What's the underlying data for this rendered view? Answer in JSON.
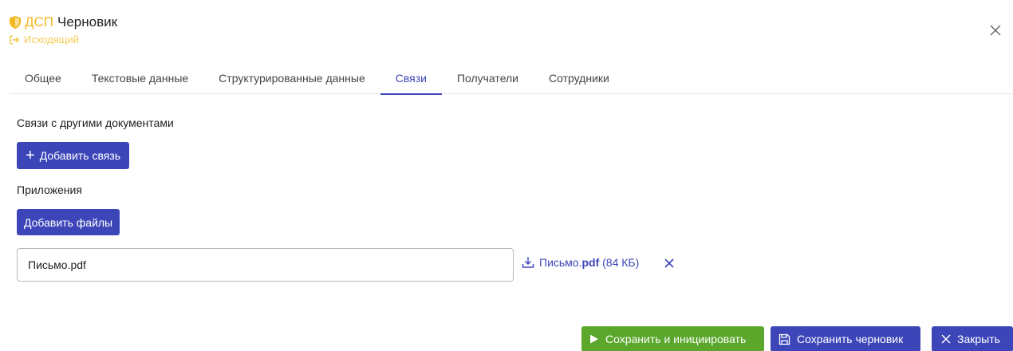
{
  "header": {
    "classification": "ДСП",
    "title": "Черновик",
    "subtitle": "Исходящий"
  },
  "tabs": [
    {
      "label": "Общее",
      "active": false
    },
    {
      "label": "Текстовые данные",
      "active": false
    },
    {
      "label": "Структурированные данные",
      "active": false
    },
    {
      "label": "Связи",
      "active": true
    },
    {
      "label": "Получатели",
      "active": false
    },
    {
      "label": "Сотрудники",
      "active": false
    }
  ],
  "links_section": {
    "label": "Связи с другими документами",
    "add_button": "Добавить связь"
  },
  "attachments_section": {
    "label": "Приложения",
    "add_button": "Добавить файлы",
    "file_name_value": "Письмо.pdf",
    "file_link_name": "Письмо.",
    "file_link_ext": "pdf",
    "file_link_size": "(84 КБ)"
  },
  "footer": {
    "save_initiate": "Сохранить и инициировать",
    "save_draft": "Сохранить черновик",
    "close": "Закрыть"
  },
  "colors": {
    "accent": "#3d46b8",
    "warning": "#f3b81f",
    "success": "#5aa72c"
  }
}
